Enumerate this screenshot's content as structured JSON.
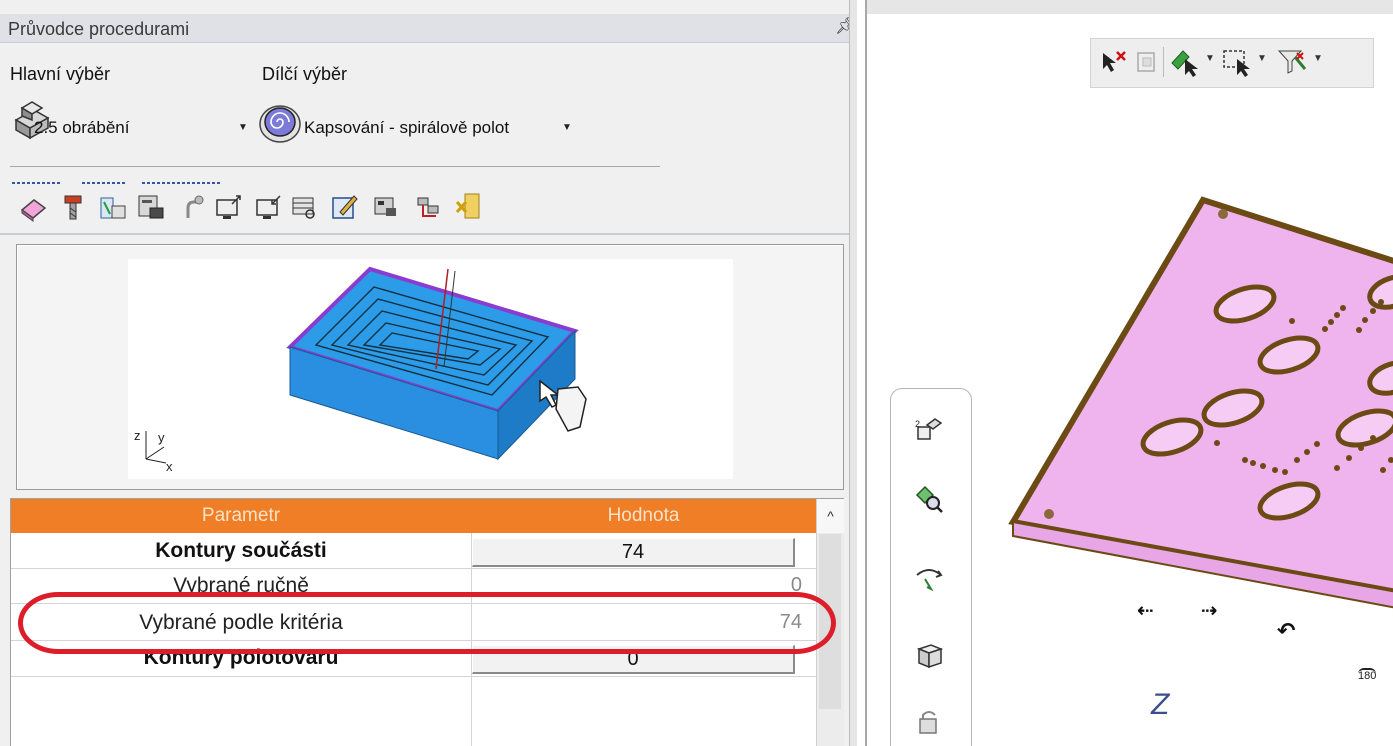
{
  "panel": {
    "title": "Průvodce procedurami",
    "pin_icon": "pin-icon"
  },
  "main_selection": {
    "label": "Hlavní výběr",
    "value": "2.5 obrábění",
    "icon": "machining-2-5-icon"
  },
  "sub_selection": {
    "label": "Dílčí výběr",
    "value": "Kapsování - spirálově polot",
    "icon": "spiral-pocket-icon"
  },
  "toolbar_icons": [
    "geometry-icon",
    "tool-icon",
    "parameters-icon",
    "settings-icon",
    "link-icon",
    "export-icon",
    "import-icon",
    "table-icon",
    "edit-icon",
    "list-icon",
    "tree-icon",
    "exit-icon"
  ],
  "preview": {
    "axis_label_z": "z",
    "axis_label_y": "y",
    "axis_label_x": "x"
  },
  "table": {
    "headers": [
      "Parametr",
      "Hodnota"
    ],
    "rows": [
      {
        "name": "Kontury součásti",
        "value": "74"
      },
      {
        "name": "Vybrané ručně",
        "value": "0"
      },
      {
        "name": "Vybrané podle kritéria",
        "value": "74"
      },
      {
        "name": "Kontury polotovaru",
        "value": "0"
      }
    ]
  },
  "viewport": {
    "selection_toolbar_icons": [
      "deselect-icon",
      "select-box-icon",
      "pick-icon",
      "window-select-icon",
      "filter-icon"
    ],
    "side_toolbar_icons": [
      "rotate-view-icon",
      "zoom-fit-icon",
      "orbit-icon",
      "view-cube-icon",
      "lock-icon"
    ],
    "axis_label": "Z",
    "view_180": "180",
    "colors": {
      "part_top": "#f3bff2",
      "part_edge": "#6b4a14",
      "part_side": "#e8a6e6"
    }
  }
}
